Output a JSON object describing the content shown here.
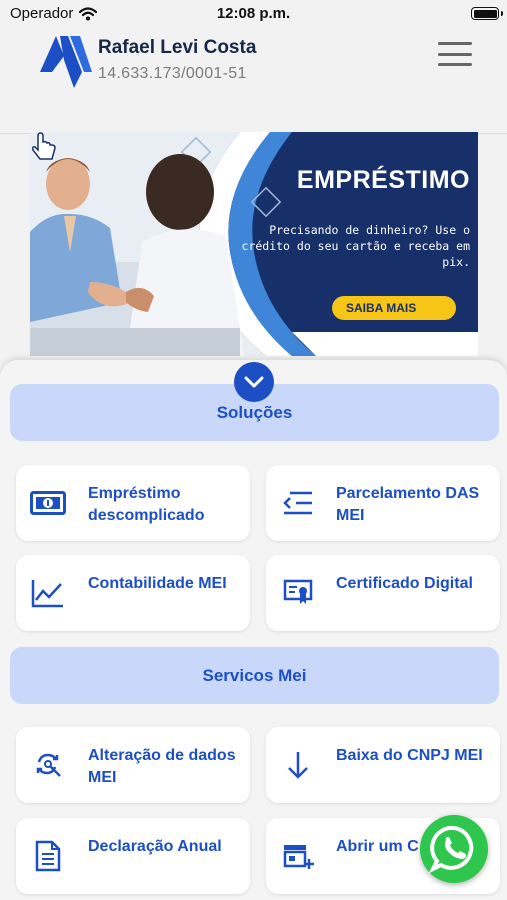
{
  "status_bar": {
    "carrier": "Operador",
    "time": "12:08 p.m."
  },
  "header": {
    "user_name": "Rafael Levi Costa",
    "document": "14.633.173/0001-51"
  },
  "banner": {
    "title": "EMPRÉSTIMO",
    "text": "Precisando de dinheiro? Use o crédito do seu cartão e receba em pix.",
    "cta": "SAIBA MAIS"
  },
  "sections": {
    "solucoes": {
      "title": "Soluções",
      "items": [
        {
          "label": "Empréstimo descomplicado",
          "icon": "money-bill-icon"
        },
        {
          "label": "Parcelamento DAS MEI",
          "icon": "list-arrow-icon"
        },
        {
          "label": "Contabilidade MEI",
          "icon": "chart-line-icon"
        },
        {
          "label": "Certificado Digital",
          "icon": "certificate-icon"
        }
      ]
    },
    "servicos": {
      "title": "Servicos Mei",
      "items": [
        {
          "label": "Alteração de dados MEI",
          "icon": "refresh-search-icon"
        },
        {
          "label": "Baixa do CNPJ MEI",
          "icon": "arrow-down-icon"
        },
        {
          "label": "Declaração Anual",
          "icon": "document-icon"
        },
        {
          "label": "Abrir um C MEI",
          "icon": "add-store-icon"
        }
      ]
    }
  },
  "colors": {
    "accent": "#1d4fc4",
    "section_bg": "#c9d8fa",
    "banner_bg": "#17306a",
    "cta": "#f7c515",
    "whatsapp": "#2ec64d"
  }
}
